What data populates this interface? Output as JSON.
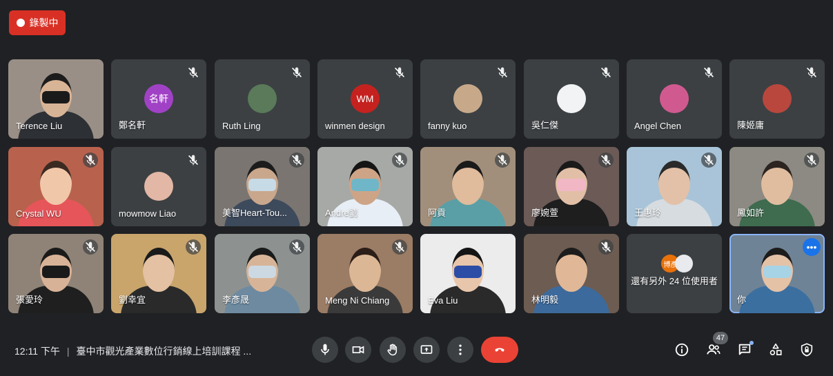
{
  "recording": {
    "label": "錄製中",
    "color": "#d93025"
  },
  "tiles": [
    {
      "name": "Terence Liu",
      "type": "video",
      "muted": false,
      "bg": "#9a8f86",
      "skin": "#d8b496",
      "shirt": "#2d3035",
      "hair": "#1c1c1c",
      "mask": "#1a1a1a"
    },
    {
      "name": "鄭名軒",
      "type": "avatar",
      "muted": true,
      "avatar_text": "名軒",
      "avatar_color": "#a142c6"
    },
    {
      "name": "Ruth Ling",
      "type": "avatar",
      "muted": true,
      "avatar_text": "",
      "avatar_color": "#5a7a5a"
    },
    {
      "name": "winmen design",
      "type": "avatar",
      "muted": true,
      "avatar_text": "WM",
      "avatar_color": "#c5221f"
    },
    {
      "name": "fanny kuo",
      "type": "avatar",
      "muted": true,
      "avatar_text": "",
      "avatar_color": "#c7a98a"
    },
    {
      "name": "吳仁傑",
      "type": "avatar",
      "muted": true,
      "avatar_text": "",
      "avatar_color": "#f1f3f4"
    },
    {
      "name": "Angel Chen",
      "type": "avatar",
      "muted": true,
      "avatar_text": "",
      "avatar_color": "#d05a90"
    },
    {
      "name": "陳姬庸",
      "type": "avatar",
      "muted": true,
      "avatar_text": "",
      "avatar_color": "#b9473d"
    },
    {
      "name": "Crystal WU",
      "type": "video",
      "muted": true,
      "bg": "#b8624d",
      "skin": "#f1c7a9",
      "shirt": "#e6555a",
      "hair": "#3b2a22",
      "mask": ""
    },
    {
      "name": "mowmow Liao",
      "type": "avatar",
      "muted": true,
      "avatar_text": "",
      "avatar_color": "#e2b7a6"
    },
    {
      "name": "美智Heart-Tou...",
      "type": "video",
      "muted": true,
      "bg": "#7a7571",
      "skin": "#c9a78d",
      "shirt": "#3d4a5c",
      "hair": "#1c1c1c",
      "mask": "#c7dbe6"
    },
    {
      "name": "Andre劉",
      "type": "video",
      "muted": true,
      "bg": "#a7a9a6",
      "skin": "#cea487",
      "shirt": "#e8eef5",
      "hair": "#151515",
      "mask": "#6fb7c8"
    },
    {
      "name": "阿貢",
      "type": "video",
      "muted": true,
      "bg": "#a28f7b",
      "skin": "#e0bb9c",
      "shirt": "#5a9fa6",
      "hair": "#1a1a1a",
      "mask": ""
    },
    {
      "name": "廖婉萱",
      "type": "video",
      "muted": true,
      "bg": "#6b5a56",
      "skin": "#e1bfa6",
      "shirt": "#1e1e1e",
      "hair": "#1a1a1a",
      "mask": "#f1b7c5"
    },
    {
      "name": "王惠玲",
      "type": "video",
      "muted": true,
      "bg": "#a9c4d8",
      "skin": "#e3c1a8",
      "shirt": "#d6dce0",
      "hair": "#2a2a2a",
      "mask": ""
    },
    {
      "name": "鳳如許",
      "type": "video",
      "muted": true,
      "bg": "#8c8a82",
      "skin": "#e0bd9f",
      "shirt": "#3f6b4f",
      "hair": "#2b2421",
      "mask": ""
    },
    {
      "name": "張愛玲",
      "type": "video",
      "muted": true,
      "bg": "#8f8377",
      "skin": "#d8b297",
      "shirt": "#1f1f1f",
      "hair": "#1a1a1a",
      "mask": "#1a1a1a"
    },
    {
      "name": "劉幸宜",
      "type": "video",
      "muted": true,
      "bg": "#c9a56c",
      "skin": "#e4c1a3",
      "shirt": "#2a2a2a",
      "hair": "#1a1a1a",
      "mask": ""
    },
    {
      "name": "李彥晟",
      "type": "video",
      "muted": true,
      "bg": "#8d9290",
      "skin": "#d7b498",
      "shirt": "#6d8aa0",
      "hair": "#1a1a1a",
      "mask": "#cdd9e2"
    },
    {
      "name": "Meng Ni Chiang",
      "type": "video",
      "muted": true,
      "bg": "#9b7c65",
      "skin": "#dcb796",
      "shirt": "#3a3a3a",
      "hair": "#2b1d17",
      "mask": ""
    },
    {
      "name": "Eva Liu",
      "type": "video",
      "muted": false,
      "bg": "#ececec",
      "skin": "#e8c6ab",
      "shirt": "#2a2a2a",
      "hair": "#141414",
      "mask": "#2c4da6"
    },
    {
      "name": "林明毅",
      "type": "video",
      "muted": true,
      "bg": "#6d5c52",
      "skin": "#e1b897",
      "shirt": "#3d6a9c",
      "hair": "#1c1c1c",
      "mask": ""
    },
    {
      "name": "還有另外 24 位使用者",
      "type": "others",
      "muted": false,
      "avatar_text": "博彥",
      "avatar_color": "#e8710a"
    },
    {
      "name": "你",
      "type": "video",
      "muted": false,
      "selfview": true,
      "bg": "#6f8396",
      "skin": "#e4c2a6",
      "shirt": "#3b6fa0",
      "hair": "#1c1c1c",
      "mask": "#a7d3e6"
    }
  ],
  "bottom": {
    "time": "12:11 下午",
    "separator": "|",
    "meeting_title": "臺中市觀光產業數位行銷線上培訓課程 ...",
    "participants_count": "47",
    "end_call_color": "#ea4335"
  },
  "controls": [
    "mic-icon",
    "camera-icon",
    "raise-hand-icon",
    "present-screen-icon",
    "more-options-icon",
    "end-call-icon"
  ],
  "right_icons": [
    "info-icon",
    "people-icon",
    "chat-icon",
    "activities-icon",
    "host-controls-icon"
  ]
}
